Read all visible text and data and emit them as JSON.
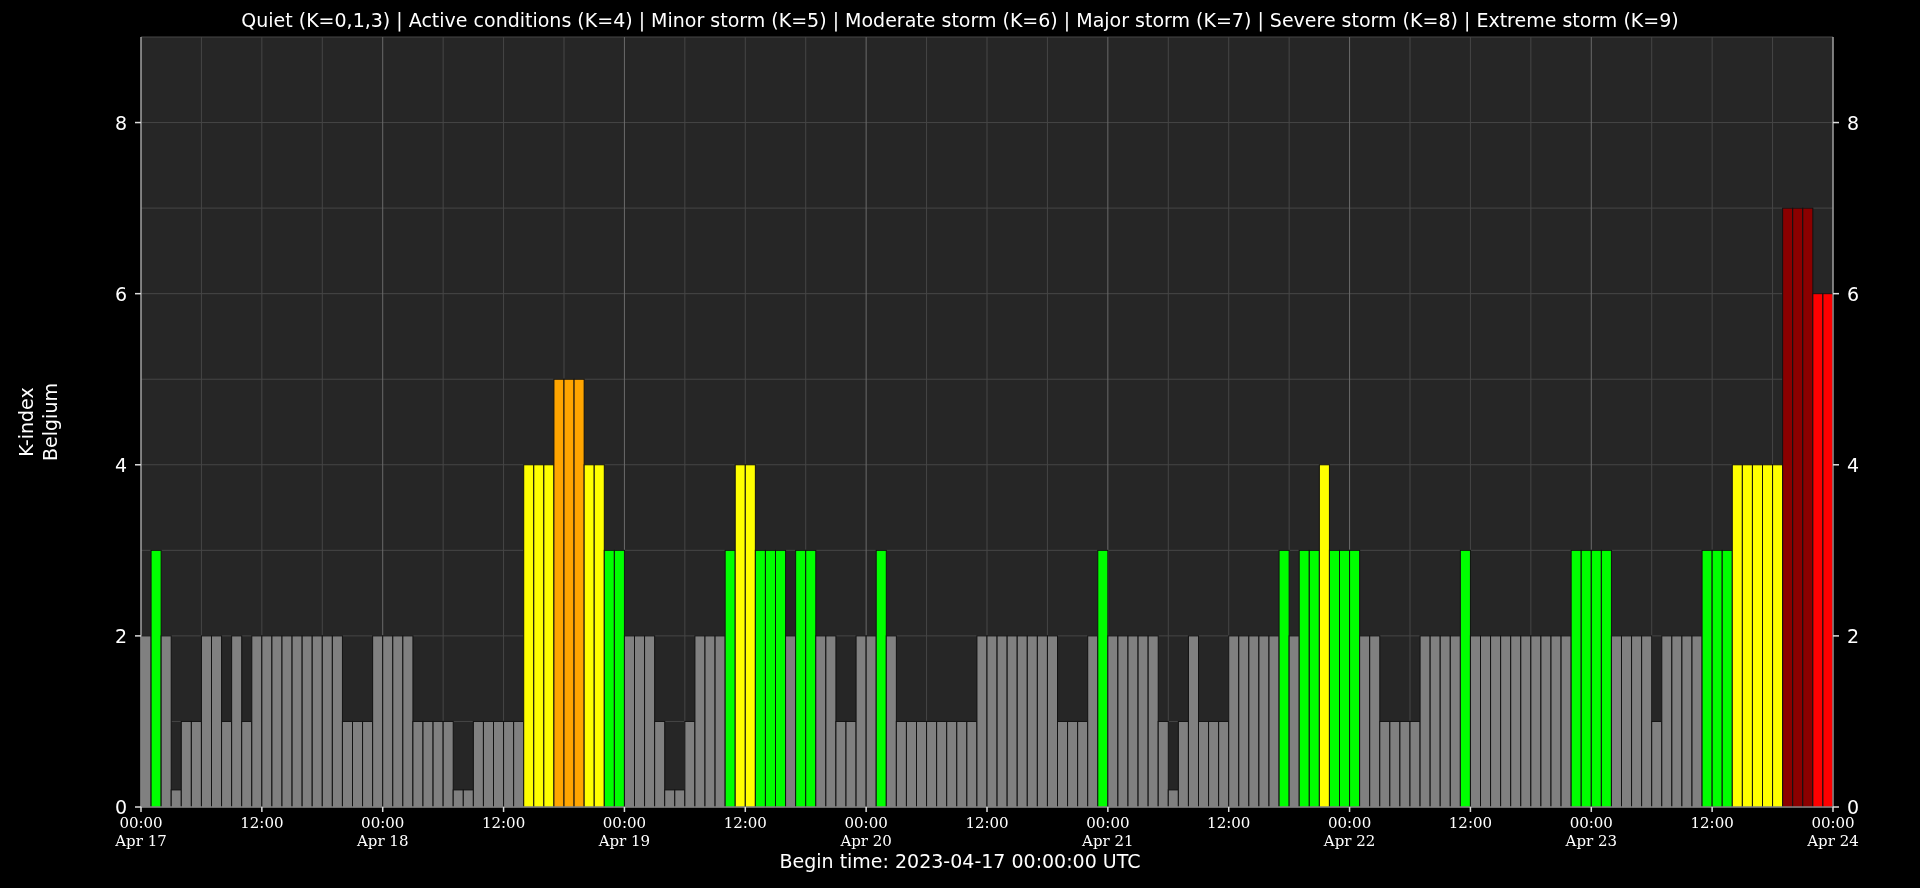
{
  "chart_data": {
    "type": "bar",
    "title": "Quiet (K=0,1,3) | Active conditions (K=4) | Minor storm (K=5) | Moderate storm (K=6) | Major storm (K=7) | Severe storm (K=8) | Extreme storm (K=9)",
    "xlabel": "Begin time: 2023-04-17 00:00:00 UTC",
    "ylabel": "K-index\nBelgium",
    "ylim": [
      0,
      9
    ],
    "categories": [
      "00:00\nApr 17",
      null,
      null,
      null,
      null,
      null,
      null,
      null,
      null,
      null,
      null,
      null,
      "12:00",
      null,
      null,
      null,
      null,
      null,
      null,
      null,
      null,
      null,
      null,
      null,
      "00:00\nApr 18",
      null,
      null,
      null,
      null,
      null,
      null,
      null,
      null,
      null,
      null,
      null,
      "12:00",
      null,
      null,
      null,
      null,
      null,
      null,
      null,
      null,
      null,
      null,
      null,
      "00:00\nApr 19",
      null,
      null,
      null,
      null,
      null,
      null,
      null,
      null,
      null,
      null,
      null,
      "12:00",
      null,
      null,
      null,
      null,
      null,
      null,
      null,
      null,
      null,
      null,
      null,
      "00:00\nApr 20",
      null,
      null,
      null,
      null,
      null,
      null,
      null,
      null,
      null,
      null,
      null,
      "12:00",
      null,
      null,
      null,
      null,
      null,
      null,
      null,
      null,
      null,
      null,
      null,
      "00:00\nApr 21",
      null,
      null,
      null,
      null,
      null,
      null,
      null,
      null,
      null,
      null,
      null,
      "12:00",
      null,
      null,
      null,
      null,
      null,
      null,
      null,
      null,
      null,
      null,
      null,
      "00:00\nApr 22",
      null,
      null,
      null,
      null,
      null,
      null,
      null,
      null,
      null,
      null,
      null,
      "12:00",
      null,
      null,
      null,
      null,
      null,
      null,
      null,
      null,
      null,
      null,
      null,
      "00:00\nApr 23",
      null,
      null,
      null,
      null,
      null,
      null,
      null,
      null,
      null,
      null,
      null,
      "12:00",
      null,
      null,
      null,
      null,
      null,
      null,
      null,
      null,
      null,
      null,
      null,
      "00:00\nApr 24"
    ],
    "yticks": [
      0,
      2,
      4,
      6,
      8
    ],
    "y2ticks": [
      0,
      2,
      4,
      6,
      8
    ],
    "y2lim": [
      0,
      9
    ],
    "grid": true,
    "series": [
      {
        "values": [
          2,
          3,
          2,
          0.2,
          1,
          1,
          2,
          2,
          1,
          2,
          1,
          2,
          2,
          2,
          2,
          2,
          2,
          2,
          2,
          2,
          1,
          1,
          1,
          2,
          2,
          2,
          2,
          1,
          1,
          1,
          1,
          0.2,
          0.2,
          1,
          1,
          1,
          1,
          1,
          4,
          4,
          4,
          5,
          5,
          5,
          4,
          4,
          3,
          3,
          2,
          2,
          2,
          1,
          0.2,
          0.2,
          1,
          2,
          2,
          2,
          3,
          4,
          4,
          3,
          3,
          3,
          2,
          3,
          3,
          2,
          2,
          1,
          1,
          2,
          2,
          3,
          2,
          1,
          1,
          1,
          1,
          1,
          1,
          1,
          1,
          2,
          2,
          2,
          2,
          2,
          2,
          2,
          2,
          1,
          1,
          1,
          2,
          3,
          2,
          2,
          2,
          2,
          2,
          1,
          0.2,
          1,
          2,
          1,
          1,
          1,
          2,
          2,
          2,
          2,
          2,
          3,
          2,
          3,
          3,
          4,
          3,
          3,
          3,
          2,
          2,
          1,
          1,
          1,
          1,
          2,
          2,
          2,
          2,
          3,
          2,
          2,
          2,
          2,
          2,
          2,
          2,
          2,
          2,
          2,
          3,
          3,
          3,
          3,
          2,
          2,
          2,
          2,
          1,
          2,
          2,
          2,
          2,
          3,
          3,
          3,
          4,
          4,
          4,
          4,
          4,
          7,
          7,
          7,
          6,
          6,
          null
        ]
      }
    ]
  }
}
